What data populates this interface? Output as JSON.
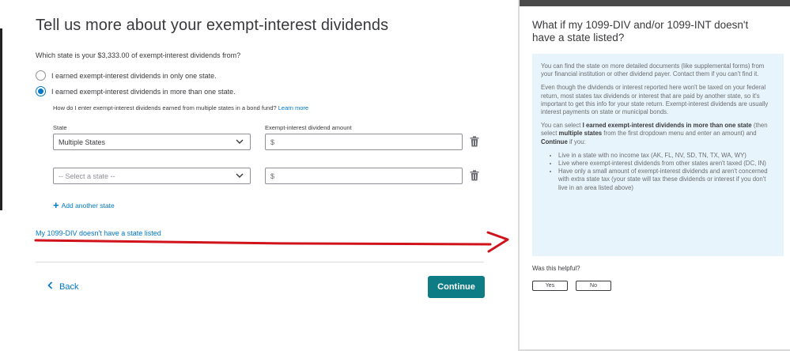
{
  "main": {
    "title": "Tell us more about your exempt-interest dividends",
    "question": "Which state is your $3,333.00 of exempt-interest dividends from?",
    "radios": [
      {
        "label": "I earned exempt-interest dividends in only one state.",
        "checked": false
      },
      {
        "label": "I earned exempt-interest dividends in more than one state.",
        "checked": true
      }
    ],
    "bond_fund_help": "How do I enter exempt-interest dividends earned from multiple states in a bond fund?",
    "learn_more": "Learn more",
    "state_label": "State",
    "amount_label": "Exempt-interest dividend amount",
    "rows": [
      {
        "state": "Multiple States",
        "amount_prefix": "$"
      },
      {
        "state": "-- Select a state --",
        "amount_prefix": "$"
      }
    ],
    "add_state": "Add another state",
    "no_state_link": "My 1099-DIV doesn't have a state listed",
    "back": "Back",
    "continue": "Continue"
  },
  "panel": {
    "title": "What if my 1099-DIV and/or 1099-INT doesn't have a state listed?",
    "p1": "You can find the state on more detailed documents (like supplemental forms) from your financial institution or other dividend payer. Contact them if you can't find it.",
    "p2": "Even though the dividends or interest reported here won't be taxed on your federal return, most states tax dividends or interest that are paid by another state, so it's important to get this info for your state return. Exempt-interest dividends are usually interest payments on state or municipal bonds.",
    "p3_a": "You can select ",
    "p3_b": "I earned exempt-interest dividends in more than one state",
    "p3_c": " (then select ",
    "p3_d": "multiple states",
    "p3_e": " from the first dropdown menu and enter an amount) and ",
    "p3_f": "Continue",
    "p3_g": " if you:",
    "bullets": [
      "Live in a state with no income tax (AK, FL, NV, SD, TN, TX, WA, WY)",
      "Live where exempt-interest dividends from other states aren't taxed (DC, IN)",
      "Have only a small amount of exempt-interest dividends and aren't concerned with extra state tax (your state will tax these dividends or interest if you don't live in an area listed above)"
    ],
    "helpful": "Was this helpful?",
    "yes": "Yes",
    "no": "No"
  },
  "colors": {
    "link": "#0077c5",
    "continue_bg": "#0d7c85",
    "annotation_red": "#d0121b",
    "info_bg": "#e8f4fb"
  }
}
